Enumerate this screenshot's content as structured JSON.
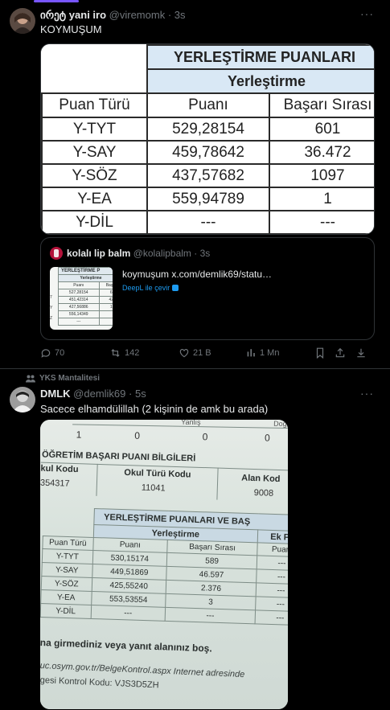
{
  "tweet1": {
    "display_name": "ირეტ yani iro",
    "handle": "@viremomk",
    "time": "· 3s",
    "more": "···",
    "text": "KOYMUŞUM",
    "table": {
      "header_main": "YERLEŞTİRME PUANLARI",
      "header_sub": "Yerleştirme",
      "col1": "Puan Türü",
      "col2": "Puanı",
      "col3": "Başarı Sırası",
      "rows": [
        {
          "type": "Y-TYT",
          "score": "529,28154",
          "rank": "601"
        },
        {
          "type": "Y-SAY",
          "score": "459,78642",
          "rank": "36.472"
        },
        {
          "type": "Y-SÖZ",
          "score": "437,57682",
          "rank": "1097"
        },
        {
          "type": "Y-EA",
          "score": "559,94789",
          "rank": "1"
        },
        {
          "type": "Y-DİL",
          "score": "---",
          "rank": "---"
        }
      ]
    },
    "quote": {
      "display_name": "kolalı lip balm",
      "handle": "@kolalipbalm",
      "time": "· 3s",
      "text": "koymuşum x.com/demlik69/statu…",
      "translate": "DeepL ile çevir",
      "thumb_header": "YERLEŞTİRME P",
      "thumb_sub": "Yerleştirme",
      "thumb_cols": [
        "Puanı",
        "Başar"
      ],
      "thumb_rows": [
        {
          "score": "527,28154",
          "rank": "6"
        },
        {
          "score": "451,42314",
          "rank": "42"
        },
        {
          "score": "427,56886",
          "rank": "1"
        },
        {
          "score": "556,14349",
          "rank": ""
        },
        {
          "score": "---",
          "rank": ""
        }
      ],
      "thumb_left_marks": [
        "7",
        "Y",
        "Z"
      ]
    },
    "actions": {
      "replies": "70",
      "retweets": "142",
      "likes": "21 B",
      "views": "1 Mn"
    }
  },
  "tweet2": {
    "context": "YKS Mantalitesi",
    "display_name": "DMLK",
    "handle": "@demlik69",
    "time": "· 5s",
    "more": "···",
    "text": "Sacece elhamdülillah (2 kişinin de amk bu arada)",
    "photo": {
      "top_row": [
        "1",
        "0",
        "0",
        "0"
      ],
      "top_labels": [
        "Yanlış",
        "Doğr"
      ],
      "section_title": "ÖĞRETİM BAŞARI PUANI BİLGİLERİ",
      "okul_kodu_label": "kul Kodu",
      "okul_kodu": "354317",
      "okul_turu_label": "Okul Türü Kodu",
      "okul_turu": "11041",
      "alan_label": "Alan Kod",
      "alan": "9008",
      "header_main": "YERLEŞTİRME PUANLARI VE BAŞ",
      "header_sub": "Yerleştirme",
      "header_ek": "Ek Pu",
      "col1": "Puan Türü",
      "col2": "Puanı",
      "col3": "Başarı Sırası",
      "col4": "Puanı",
      "rows": [
        {
          "type": "Y-TYT",
          "score": "530,15174",
          "rank": "589",
          "ek": "---"
        },
        {
          "type": "Y-SAY",
          "score": "449,51869",
          "rank": "46.597",
          "ek": "---"
        },
        {
          "type": "Y-SÖZ",
          "score": "425,55240",
          "rank": "2.376",
          "ek": "---"
        },
        {
          "type": "Y-EA",
          "score": "553,53554",
          "rank": "3",
          "ek": "---"
        },
        {
          "type": "Y-DİL",
          "score": "---",
          "rank": "---",
          "ek": "---"
        }
      ],
      "notice": "na girmediniz veya yanıt alanınız boş.",
      "url_line": "uc.osym.gov.tr/BelgeKontrol.aspx Internet adresinde",
      "code_line": "gesi Kontrol Kodu: VJS3D5ZH"
    }
  },
  "colors": {
    "accent": "#7856ff",
    "link": "#1d9bf0",
    "muted": "#71767b",
    "table_header": "#d9e8f5",
    "divider": "#2f3336"
  }
}
